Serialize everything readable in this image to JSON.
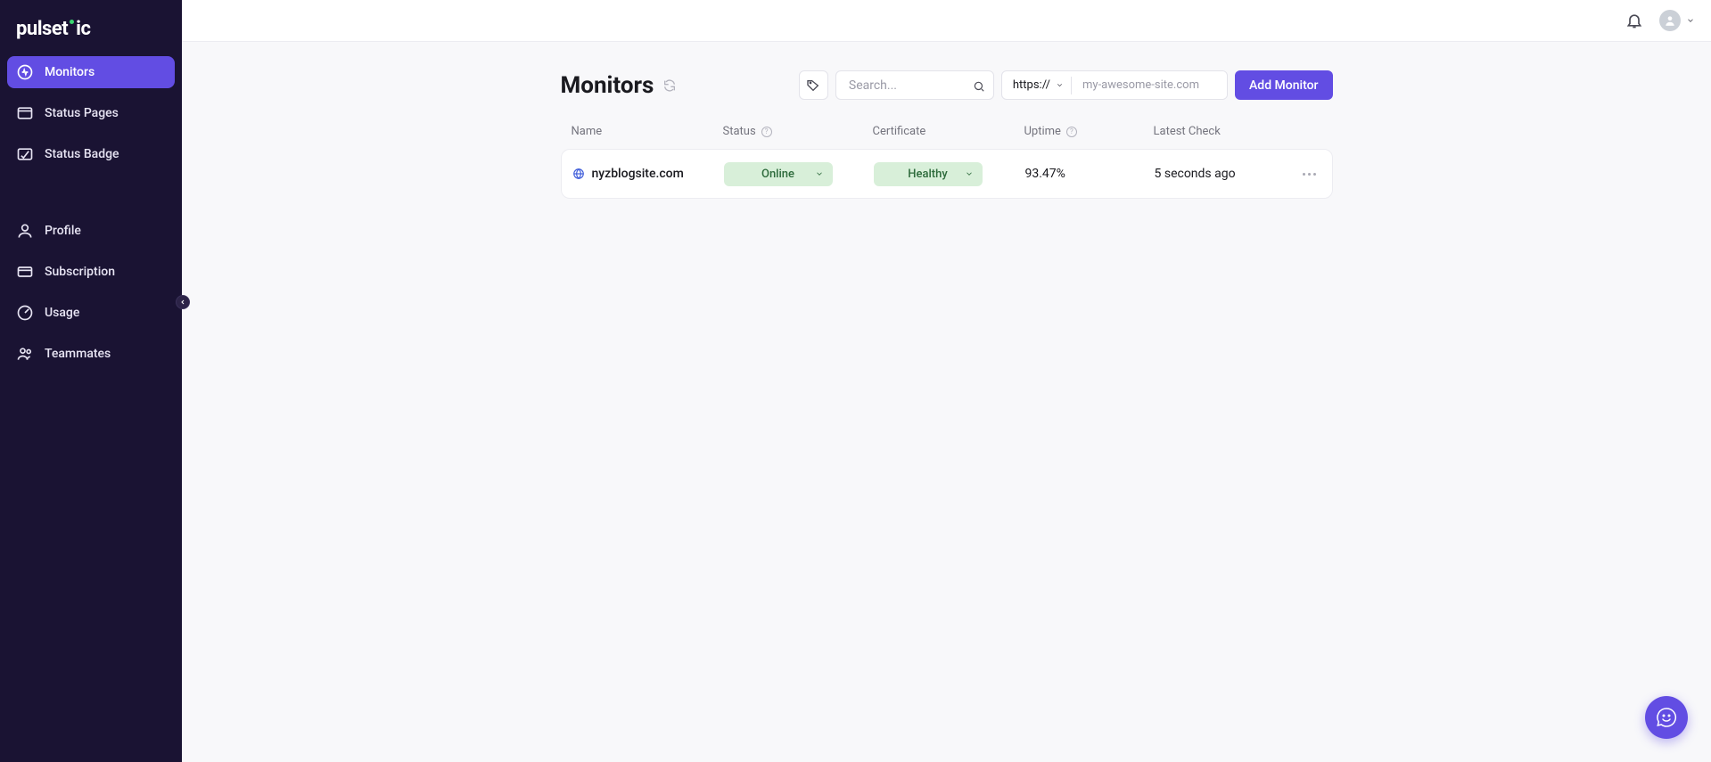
{
  "brand": "pulsetic",
  "sidebar": {
    "items": [
      {
        "label": "Monitors",
        "icon": "monitor"
      },
      {
        "label": "Status Pages",
        "icon": "window"
      },
      {
        "label": "Status Badge",
        "icon": "badge"
      }
    ],
    "items2": [
      {
        "label": "Profile",
        "icon": "user"
      },
      {
        "label": "Subscription",
        "icon": "card"
      },
      {
        "label": "Usage",
        "icon": "gauge"
      },
      {
        "label": "Teammates",
        "icon": "users"
      }
    ]
  },
  "header": {
    "title": "Monitors",
    "search_placeholder": "Search...",
    "protocol": "https://",
    "url_placeholder": "my-awesome-site.com",
    "add_button": "Add Monitor"
  },
  "table": {
    "columns": {
      "name": "Name",
      "status": "Status",
      "certificate": "Certificate",
      "uptime": "Uptime",
      "latest": "Latest Check"
    },
    "rows": [
      {
        "name": "nyzblogsite.com",
        "status": "Online",
        "certificate": "Healthy",
        "uptime": "93.47%",
        "latest": "5 seconds ago"
      }
    ]
  }
}
